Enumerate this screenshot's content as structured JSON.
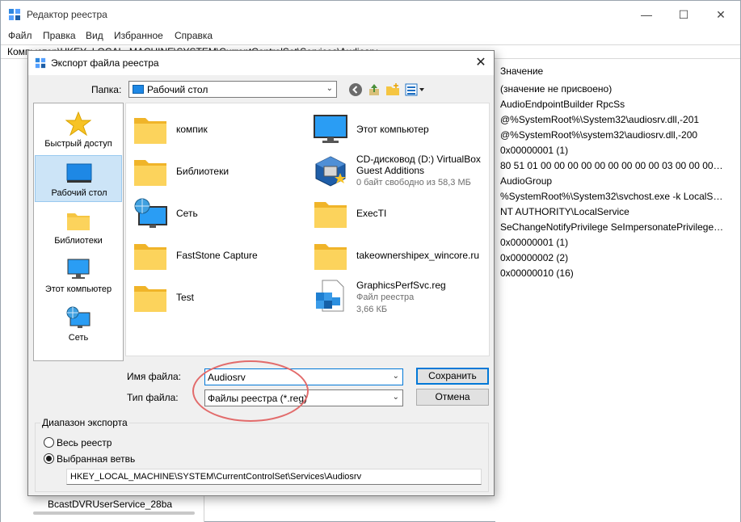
{
  "app": {
    "title": "Редактор реестра",
    "menu": [
      "Файл",
      "Правка",
      "Вид",
      "Избранное",
      "Справка"
    ],
    "address": "Компьютер\\HKEY_LOCAL_MACHINE\\SYSTEM\\CurrentControlSet\\Services\\Audiosrv",
    "tree_bottom_item": "BcastDVRUserService_28ba",
    "values_header": "Значение",
    "values": [
      "(значение не присвоено)",
      "AudioEndpointBuilder RpcSs",
      "@%SystemRoot%\\System32\\audiosrv.dll,-201",
      "@%SystemRoot%\\system32\\audiosrv.dll,-200",
      "0x00000001 (1)",
      "80 51 01 00 00 00 00 00 00 00 00 00 03 00 00 00 14 00...",
      "AudioGroup",
      "%SystemRoot%\\System32\\svchost.exe -k LocalSer...",
      "NT AUTHORITY\\LocalService",
      "SeChangeNotifyPrivilege SeImpersonatePrivilege S...",
      "0x00000001 (1)",
      "0x00000002 (2)",
      "0x00000010 (16)"
    ]
  },
  "dialog": {
    "title": "Экспорт файла реестра",
    "folder_label": "Папка:",
    "folder_value": "Рабочий стол",
    "places": [
      {
        "label": "Быстрый доступ",
        "icon": "star-icon"
      },
      {
        "label": "Рабочий стол",
        "icon": "desktop-icon"
      },
      {
        "label": "Библиотеки",
        "icon": "libraries-folder-icon"
      },
      {
        "label": "Этот компьютер",
        "icon": "computer-icon"
      },
      {
        "label": "Сеть",
        "icon": "network-icon"
      }
    ],
    "files": [
      {
        "name": "компик",
        "icon": "folder-icon"
      },
      {
        "name": "Этот компьютер",
        "icon": "computer-icon"
      },
      {
        "name": "Библиотеки",
        "icon": "folder-icon"
      },
      {
        "name": "CD-дисковод (D:) VirtualBox Guest Additions",
        "sub": "0 байт свободно из 58,3 МБ",
        "icon": "virtualbox-disc-icon"
      },
      {
        "name": "Сеть",
        "icon": "network-icon"
      },
      {
        "name": "ExecTI",
        "icon": "folder-icon"
      },
      {
        "name": "FastStone Capture",
        "icon": "folder-icon"
      },
      {
        "name": "takeownershipex_wincore.ru",
        "icon": "folder-icon"
      },
      {
        "name": "Test",
        "icon": "folder-icon"
      },
      {
        "name": "GraphicsPerfSvc.reg",
        "sub": "Файл реестра",
        "sub2": "3,66 КБ",
        "icon": "registry-file-icon"
      }
    ],
    "filename_label": "Имя файла:",
    "filename_value": "Audiosrv",
    "filetype_label": "Тип файла:",
    "filetype_value": "Файлы реестра (*.reg)",
    "save_label": "Сохранить",
    "cancel_label": "Отмена",
    "export_range_label": "Диапазон экспорта",
    "radio_all_label": "Весь реестр",
    "radio_branch_label": "Выбранная ветвь",
    "branch_value": "HKEY_LOCAL_MACHINE\\SYSTEM\\CurrentControlSet\\Services\\Audiosrv"
  }
}
